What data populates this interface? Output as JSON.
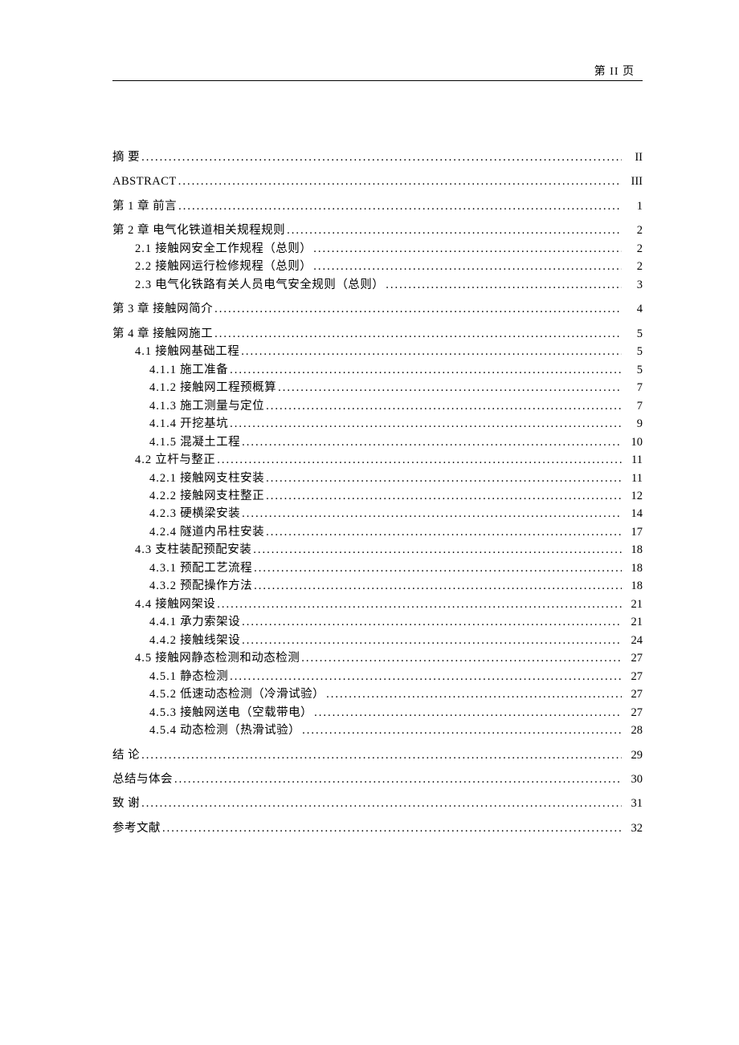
{
  "header": {
    "page_label": "第 II 页"
  },
  "toc": [
    {
      "type": "chapter",
      "title": "摘  要",
      "page": "II",
      "children": []
    },
    {
      "type": "chapter",
      "title": "ABSTRACT",
      "page": "III",
      "children": []
    },
    {
      "type": "chapter",
      "title": "第 1 章 前言",
      "page": "1",
      "children": []
    },
    {
      "type": "chapter",
      "title": "第 2 章 电气化铁道相关规程规则",
      "page": "2",
      "children": [
        {
          "level": 1,
          "num": "2.1",
          "title": "接触网安全工作规程（总则）",
          "page": "2"
        },
        {
          "level": 1,
          "num": "2.2",
          "title": "接触网运行检修规程（总则）",
          "page": "2"
        },
        {
          "level": 1,
          "num": "2.3",
          "title": "电气化铁路有关人员电气安全规则（总则）",
          "page": "3"
        }
      ]
    },
    {
      "type": "chapter",
      "title": "第 3 章 接触网简介",
      "page": "4",
      "children": []
    },
    {
      "type": "chapter",
      "title": "第 4 章 接触网施工",
      "page": "5",
      "children": [
        {
          "level": 1,
          "num": "4.1",
          "title": "接触网基础工程",
          "page": "5"
        },
        {
          "level": 2,
          "num": "4.1.1",
          "title": "施工准备",
          "page": "5"
        },
        {
          "level": 2,
          "num": "4.1.2",
          "title": "接触网工程预概算",
          "page": "7"
        },
        {
          "level": 2,
          "num": "4.1.3",
          "title": "施工测量与定位",
          "page": "7"
        },
        {
          "level": 2,
          "num": "4.1.4",
          "title": "开挖基坑",
          "page": "9"
        },
        {
          "level": 2,
          "num": "4.1.5",
          "title": "混凝土工程",
          "page": "10"
        },
        {
          "level": 1,
          "num": "4.2",
          "title": "立杆与整正",
          "page": "11"
        },
        {
          "level": 2,
          "num": "4.2.1",
          "title": "接触网支柱安装",
          "page": "11"
        },
        {
          "level": 2,
          "num": "4.2.2",
          "title": "接触网支柱整正",
          "page": "12"
        },
        {
          "level": 2,
          "num": "4.2.3",
          "title": "硬横梁安装",
          "page": "14"
        },
        {
          "level": 2,
          "num": "4.2.4",
          "title": "隧道内吊柱安装",
          "page": "17"
        },
        {
          "level": 1,
          "num": "4.3",
          "title": "  支柱装配预配安装",
          "page": "18"
        },
        {
          "level": 2,
          "num": "4.3.1",
          "title": "预配工艺流程",
          "page": "18"
        },
        {
          "level": 2,
          "num": "4.3.2",
          "title": "预配操作方法",
          "page": "18"
        },
        {
          "level": 1,
          "num": "4.4",
          "title": "  接触网架设",
          "page": "21"
        },
        {
          "level": 2,
          "num": "4.4.1",
          "title": "  承力索架设",
          "page": "21"
        },
        {
          "level": 2,
          "num": "4.4.2",
          "title": "  接触线架设",
          "page": "24"
        },
        {
          "level": 1,
          "num": "4.5",
          "title": "  接触网静态检测和动态检测",
          "page": "27"
        },
        {
          "level": 2,
          "num": "4.5.1",
          "title": "  静态检测",
          "page": "27"
        },
        {
          "level": 2,
          "num": "4.5.2",
          "title": "  低速动态检测（冷滑试验）",
          "page": "27"
        },
        {
          "level": 2,
          "num": "4.5.3",
          "title": "  接触网送电（空载带电）",
          "page": "27"
        },
        {
          "level": 2,
          "num": "4.5.4",
          "title": "  动态检测（热滑试验）",
          "page": "28"
        }
      ]
    },
    {
      "type": "chapter",
      "title": "结  论",
      "page": "29",
      "children": []
    },
    {
      "type": "chapter",
      "title": "总结与体会",
      "page": "30",
      "children": []
    },
    {
      "type": "chapter",
      "title": "致  谢",
      "page": "31",
      "children": []
    },
    {
      "type": "chapter",
      "title": "参考文献",
      "page": "32",
      "children": []
    }
  ]
}
